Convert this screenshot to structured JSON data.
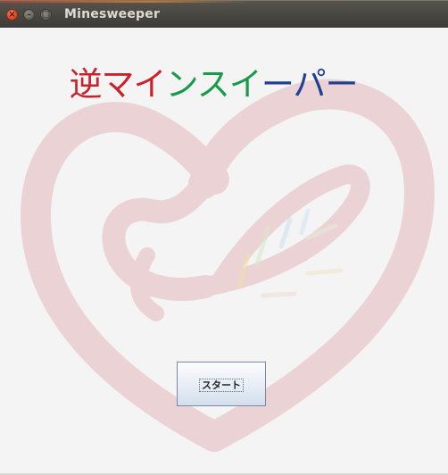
{
  "window": {
    "title": "Minesweeper",
    "close_glyph": "×",
    "minimize_glyph": "–",
    "maximize_glyph": "□"
  },
  "heading": {
    "segments": [
      {
        "text": "逆マイ",
        "color": "#c8232c"
      },
      {
        "text": "ンスイ",
        "color": "#169c48"
      },
      {
        "text": "ーパー",
        "color": "#1f3f94"
      }
    ]
  },
  "start_button": {
    "label": "スタート"
  },
  "icons": {
    "background": "heart-logo-watermark"
  }
}
